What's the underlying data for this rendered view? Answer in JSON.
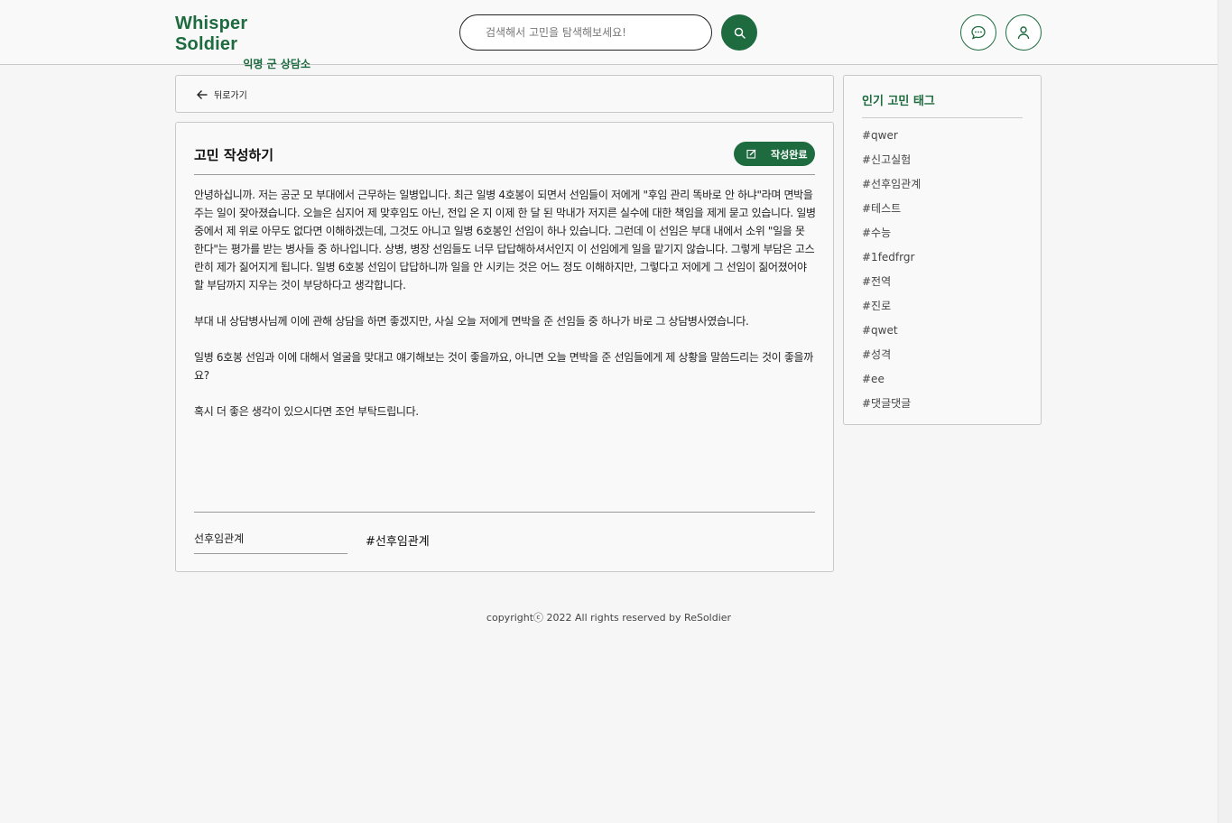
{
  "header": {
    "logo_title": "Whisper Soldier",
    "logo_subtitle": "익명 군 상담소",
    "search_placeholder": "검색해서 고민을 탐색해보세요!",
    "brand_color": "#1d6b3f"
  },
  "back": {
    "label": "뒤로가기"
  },
  "editor": {
    "title": "고민 작성하기",
    "submit_label": "작성완료",
    "paragraphs": [
      "안녕하십니까. 저는 공군 모 부대에서 근무하는 일병입니다. 최근 일병 4호봉이 되면서 선임들이 저에게 \"후임 관리 똑바로 안 하냐\"라며 면박을 주는 일이 잦아졌습니다. 오늘은 심지어 제 맞후임도 아닌, 전입 온 지 이제 한 달 된 막내가 저지른 실수에 대한 책임을 제게 묻고 있습니다. 일병 중에서 제 위로 아무도 없다면 이해하겠는데, 그것도 아니고 일병 6호봉인 선임이 하나 있습니다. 그런데 이 선임은 부대 내에서 소위 \"일을 못 한다\"는 평가를 받는 병사들 중 하나입니다. 상병, 병장 선임들도 너무 답답해하셔서인지 이 선임에게 일을 맡기지 않습니다. 그렇게 부담은 고스란히 제가 짊어지게 됩니다. 일병 6호봉 선임이 답답하니까 일을 안 시키는 것은 어느 정도 이해하지만, 그렇다고 저에게 그 선임이 짊어졌어야 할 부담까지 지우는 것이 부당하다고 생각합니다.",
      "부대 내 상담병사님께 이에 관해 상담을 하면 좋겠지만, 사실 오늘 저에게 면박을 준 선임들 중 하나가 바로 그 상담병사였습니다.",
      "일병 6호봉 선임과 이에 대해서 얼굴을 맞대고 얘기해보는 것이 좋을까요, 아니면 오늘 면박을 준 선임들에게 제 상황을 말씀드리는 것이 좋을까요?",
      "혹시 더 좋은 생각이 있으시다면 조언 부탁드립니다."
    ],
    "tag_input_value": "선후임관계",
    "tag_chip": "#선후임관계"
  },
  "sidebar": {
    "title": "인기 고민 태그",
    "tags": [
      "#qwer",
      "#신고실험",
      "#선후임관계",
      "#테스트",
      "#수능",
      "#1fedfrgr",
      "#전역",
      "#진로",
      "#qwet",
      "#성격",
      "#ee",
      "#댓글댓글"
    ]
  },
  "footer": {
    "copyright": "copyrightⓒ 2022 All rights reserved by ReSoldier"
  }
}
